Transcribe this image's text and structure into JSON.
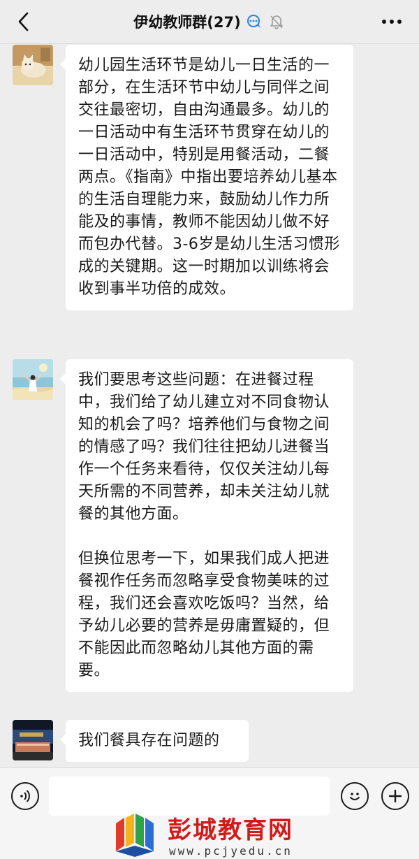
{
  "header": {
    "title": "伊幼教师群(27)",
    "back_icon": "chevron-left-icon",
    "group_icon": "chat-bubble-icon",
    "mute_icon": "bell-off-icon",
    "more_icon": "ellipsis-icon"
  },
  "messages": [
    {
      "avatar": "avatar-cat",
      "paragraphs": [
        "幼儿园生活环节是幼儿一日生活的一部分，在生活环节中幼儿与同伴之间交往最密切，自由沟通最多。幼儿的一日活动中有生活环节贯穿在幼儿的一日活动中，特别是用餐活动，二餐两点。《指南》中指出要培养幼儿基本的生活自理能力来，鼓励幼儿作力所能及的事情，教师不能因幼儿做不好而包办代替。3-6岁是幼儿生活习惯形成的关键期。这一时期加以训练将会收到事半功倍的成效。"
      ]
    },
    {
      "avatar": "avatar-woman",
      "paragraphs": [
        "我们要思考这些问题：在进餐过程中，我们给了幼儿建立对不同食物认知的机会了吗？培养他们与食物之间的情感了吗？我们往往把幼儿进餐当作一个任务来看待，仅仅关注幼儿每天所需的不同营养，却未关注幼儿就餐的其他方面。",
        "但换位思考一下，如果我们成人把进餐视作任务而忽略享受食物美味的过程，我们还会喜欢吃饭吗？当然，给予幼儿必要的营养是毋庸置疑的，但不能因此而忽略幼儿其他方面的需要。"
      ]
    },
    {
      "avatar": "avatar-building",
      "paragraphs": [
        "我们餐具存在问题的"
      ]
    }
  ],
  "input_bar": {
    "voice_icon": "voice-icon",
    "input_value": "",
    "emoji_icon": "emoji-icon",
    "plus_icon": "plus-icon"
  },
  "watermark": {
    "text": "彭城教育网",
    "url": "www.pcjyedu.cn"
  }
}
